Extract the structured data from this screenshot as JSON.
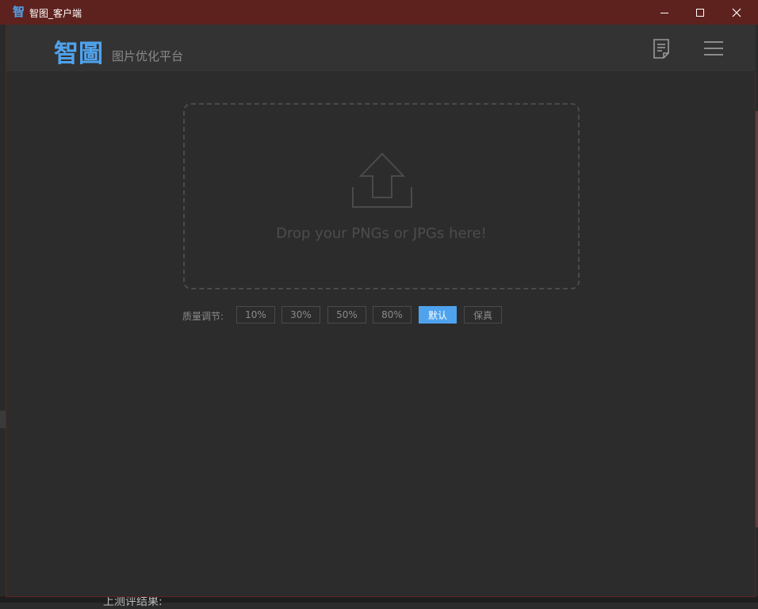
{
  "window": {
    "app_icon_glyph": "智",
    "title": "智图_客户端"
  },
  "header": {
    "logo": "智圖",
    "tagline": "图片优化平台",
    "doc_icon": "document-icon",
    "menu_icon": "hamburger-menu-icon"
  },
  "dropzone": {
    "icon": "upload-arrow-icon",
    "text": "Drop your PNGs or JPGs here!"
  },
  "quality": {
    "label": "质量调节:",
    "options": [
      {
        "label": "10%",
        "selected": false
      },
      {
        "label": "30%",
        "selected": false
      },
      {
        "label": "50%",
        "selected": false
      },
      {
        "label": "80%",
        "selected": false
      },
      {
        "label": "默认",
        "selected": true
      },
      {
        "label": "保真",
        "selected": false
      }
    ]
  },
  "background": {
    "partial_text": "上测评结果:"
  },
  "colors": {
    "accent": "#4fa3ee",
    "titlebar": "#5e221e",
    "body_bg": "#2c2c2c",
    "header_bg": "#333333"
  }
}
